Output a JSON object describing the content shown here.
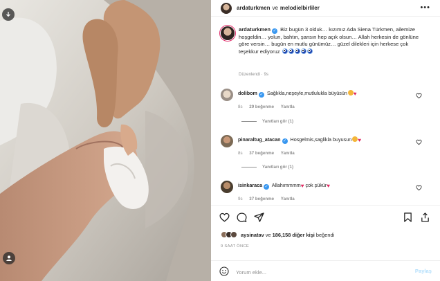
{
  "header": {
    "author": "ardaturkmen",
    "separator": "ve",
    "coauthor": "melodielbirliler",
    "more_icon": "more-horizontal-icon"
  },
  "caption": {
    "username": "ardaturkmen",
    "text": "Biz bugün 3 olduk… kızımız Ada Siena Türkmen, ailemize hoşgeldin… yolun, bahtın, şansın hep açık olsun… Allah herkesin de gönlüne göre versin… bugün en mutlu günümüz… güzel dilekleri için herkese çok teşekkur ediyoruz",
    "edited": "Düzenlendi · 9s"
  },
  "comments": [
    {
      "username": "dolibom",
      "text": "Sağlıkla,neşeyle,mutlulukla büyüsün",
      "time": "8s",
      "likes": "29 beğenme",
      "reply": "Yanıtla",
      "view_replies": "Yanıtları gör (1)"
    },
    {
      "username": "pinaraltug_atacan",
      "text": "Hosgelmis,saglikla buyusun",
      "time": "8s",
      "likes": "37 beğenme",
      "reply": "Yanıtla",
      "view_replies": "Yanıtları gör (1)"
    },
    {
      "username": "isinkaraca",
      "text": "Allahımmmm",
      "text2": "çok şükür",
      "time": "9s",
      "likes": "37 beğenme",
      "reply": "Yanıtla"
    }
  ],
  "likes": {
    "user": "aysinatav",
    "connector": "ve",
    "count": "186,158 diğer kişi",
    "suffix": "beğendi"
  },
  "time_ago": "9 SAAT ÖNCE",
  "comment_box": {
    "placeholder": "Yorum ekle...",
    "post_label": "Paylaş"
  },
  "colors": {
    "verified": "#3897f0",
    "heart": "#e0245e",
    "post_disabled": "#b2dffc",
    "muted": "#8e8e8e"
  }
}
